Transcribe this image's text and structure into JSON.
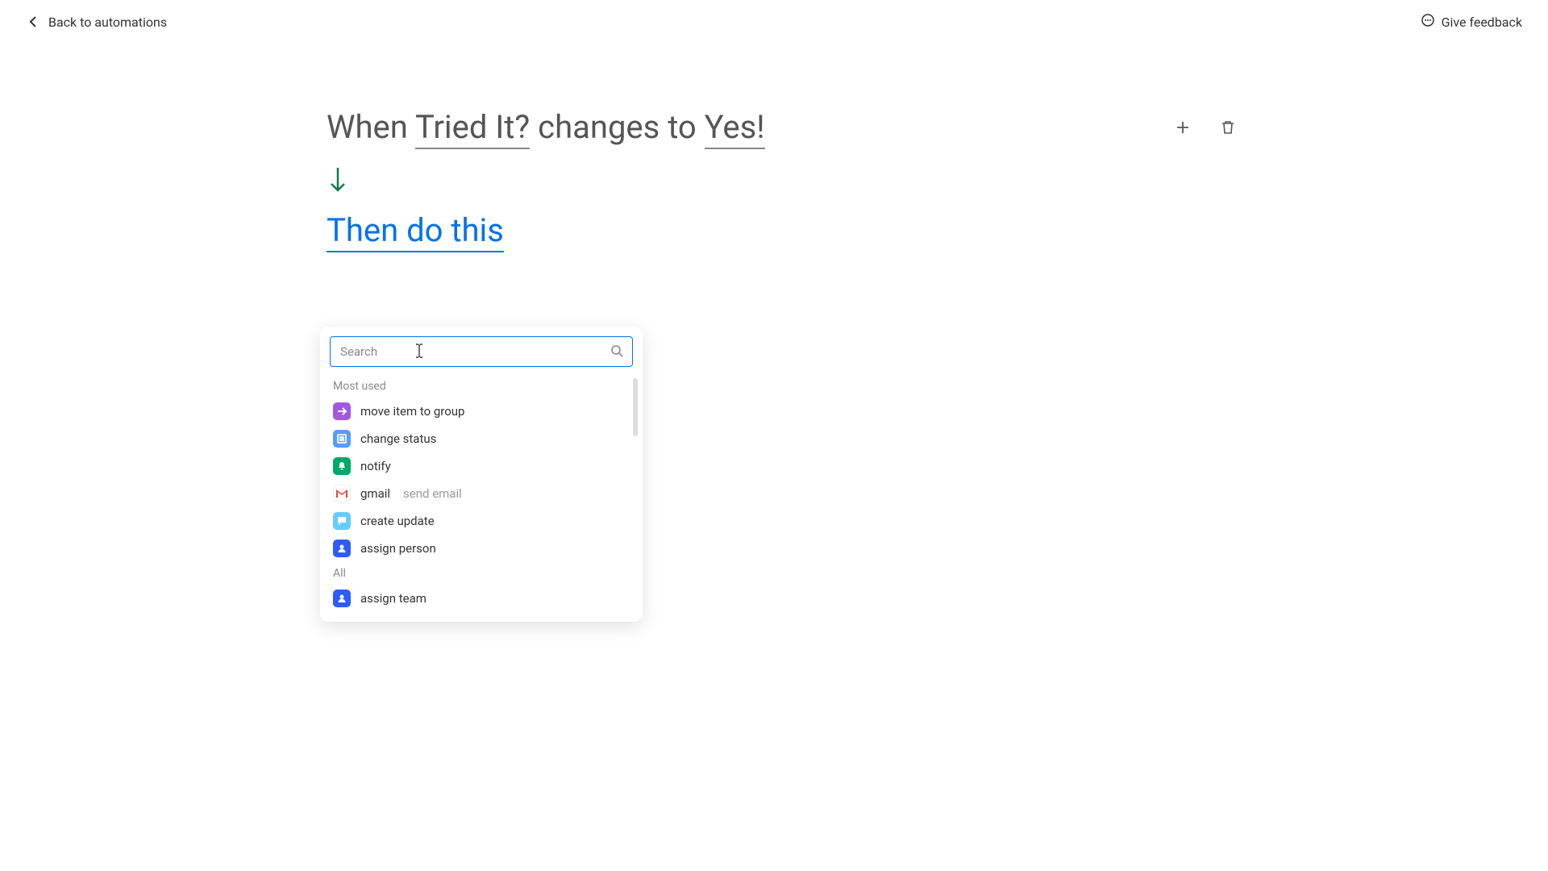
{
  "header": {
    "back_label": "Back to automations",
    "feedback_label": "Give feedback"
  },
  "trigger": {
    "prefix": "When ",
    "field": "Tried It?",
    "middle": " changes to ",
    "value": "Yes!"
  },
  "action_prompt": "Then do this",
  "search": {
    "placeholder": "Search",
    "value": ""
  },
  "sections": {
    "most_used_label": "Most used",
    "all_label": "All"
  },
  "most_used": [
    {
      "icon": "arrow-right-icon",
      "icon_class": "icon-purple",
      "label": "move item to group"
    },
    {
      "icon": "list-icon",
      "icon_class": "icon-blue",
      "label": "change status"
    },
    {
      "icon": "bell-icon",
      "icon_class": "icon-green",
      "label": "notify"
    },
    {
      "icon": "gmail-icon",
      "icon_class": "icon-white",
      "label": "gmail",
      "sublabel": "send email"
    },
    {
      "icon": "speech-icon",
      "icon_class": "icon-lightblue",
      "label": "create update"
    },
    {
      "icon": "person-icon",
      "icon_class": "icon-darkblue",
      "label": "assign person"
    }
  ],
  "all": [
    {
      "icon": "person-icon",
      "icon_class": "icon-darkblue",
      "label": "assign team"
    }
  ]
}
